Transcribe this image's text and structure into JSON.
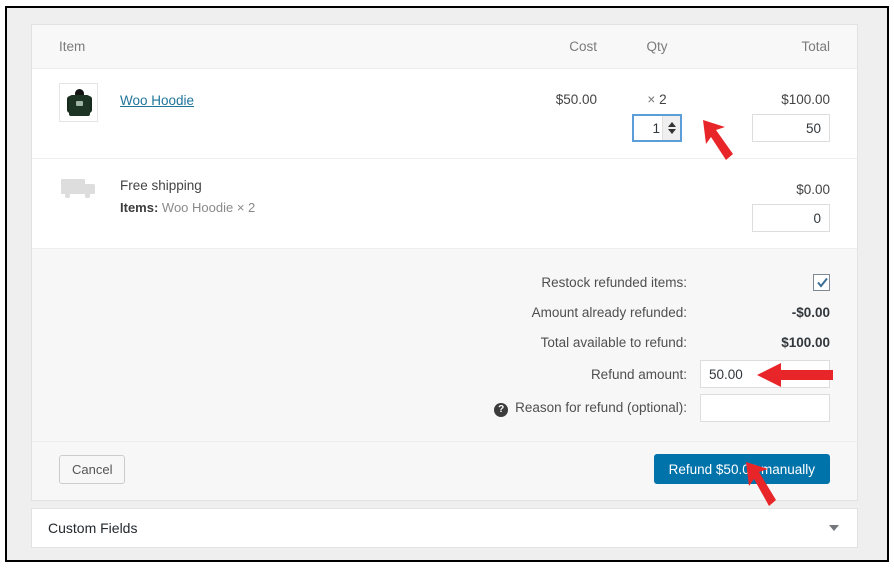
{
  "table": {
    "headers": {
      "item": "Item",
      "cost": "Cost",
      "qty": "Qty",
      "total": "Total"
    },
    "product_row": {
      "thumbnail_icon": "hoodie-thumbnail",
      "name": "Woo Hoodie",
      "cost": "$50.00",
      "qty_multiplier": "×",
      "qty": "2",
      "refund_qty_value": "1",
      "total": "$100.00",
      "refund_total_value": "50"
    },
    "shipping_row": {
      "icon": "shipping-truck-icon",
      "title": "Free shipping",
      "items_label": "Items:",
      "items_value": "Woo Hoodie × 2",
      "total": "$0.00",
      "refund_total_value": "0"
    }
  },
  "refund": {
    "restock_label": "Restock refunded items:",
    "restock_checked": true,
    "already_refunded_label": "Amount already refunded:",
    "already_refunded_value": "-$0.00",
    "total_available_label": "Total available to refund:",
    "total_available_value": "$100.00",
    "refund_amount_label": "Refund amount:",
    "refund_amount_value": "50.00",
    "reason_label": "Reason for refund (optional):",
    "reason_value": "",
    "help_glyph": "?"
  },
  "actions": {
    "cancel_label": "Cancel",
    "refund_label": "Refund $50.00 manually",
    "refund_button_color": "#0073aa"
  },
  "custom_fields": {
    "title": "Custom Fields",
    "toggle_icon": "chevron-down-icon"
  },
  "annotations": {
    "arrow_color": "#e8262a",
    "arrow_qty_spinner": "points-to-refund-qty-spinner",
    "arrow_refund_amount": "points-to-refund-amount-field",
    "arrow_refund_button": "points-to-refund-manually-button"
  }
}
